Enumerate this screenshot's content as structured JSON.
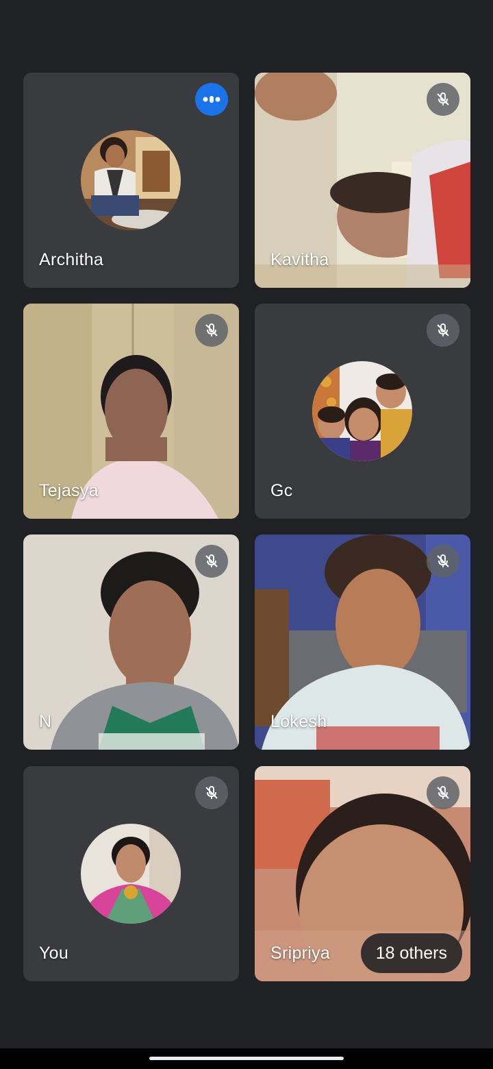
{
  "participants": [
    {
      "name": "Architha",
      "state": "speaking",
      "display": "avatar"
    },
    {
      "name": "Kavitha",
      "state": "muted",
      "display": "video"
    },
    {
      "name": "Tejasya",
      "state": "muted",
      "display": "video"
    },
    {
      "name": "Gc",
      "state": "muted",
      "display": "avatar"
    },
    {
      "name": "N",
      "state": "muted",
      "display": "video"
    },
    {
      "name": "Lokesh",
      "state": "muted",
      "display": "video"
    },
    {
      "name": "You",
      "state": "muted",
      "display": "avatar"
    },
    {
      "name": "Sripriya",
      "state": "muted",
      "display": "video"
    }
  ],
  "others_label": "18 others",
  "icons": {
    "muted": "mic-off-icon",
    "speaking": "audio-level-icon"
  },
  "colors": {
    "background": "#202124",
    "tile": "#3c4043",
    "speaking_accent": "#1a73e8",
    "mic_badge": "#5f6368"
  }
}
